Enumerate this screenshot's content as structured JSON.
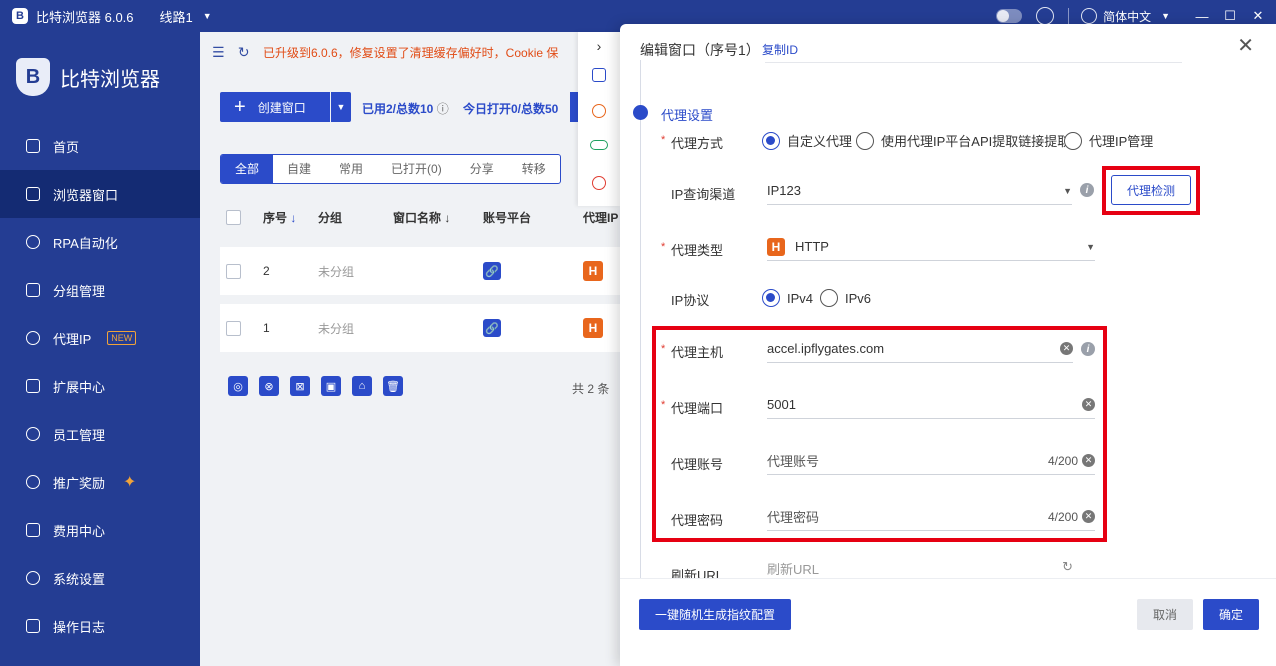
{
  "titlebar": {
    "app_title": "比特浏览器 6.0.6",
    "line": "线路1",
    "language": "简体中文"
  },
  "brand": {
    "name": "比特浏览器"
  },
  "sidebar": {
    "items": [
      {
        "label": "首页",
        "icon": "home-icon"
      },
      {
        "label": "浏览器窗口",
        "icon": "grid-icon",
        "active": true
      },
      {
        "label": "RPA自动化",
        "icon": "rpa-icon"
      },
      {
        "label": "分组管理",
        "icon": "layers-icon"
      },
      {
        "label": "代理IP",
        "icon": "location-icon",
        "badge": "NEW"
      },
      {
        "label": "扩展中心",
        "icon": "cube-icon"
      },
      {
        "label": "员工管理",
        "icon": "users-icon"
      },
      {
        "label": "推广奖励",
        "icon": "reward-icon"
      },
      {
        "label": "费用中心",
        "icon": "shield-icon"
      },
      {
        "label": "系统设置",
        "icon": "gear-icon"
      },
      {
        "label": "操作日志",
        "icon": "log-icon"
      }
    ]
  },
  "main": {
    "notice": "已升级到6.0.6，修复设置了清理缓存偏好时，Cookie 保",
    "create_label": "创建窗口",
    "used": "已用2/总数10",
    "today_open": "今日打开0/总数50",
    "tabs": [
      "全部",
      "自建",
      "常用",
      "已打开(0)",
      "分享",
      "转移"
    ],
    "columns": [
      "序号",
      "分组",
      "窗口名称",
      "账号平台",
      "代理IP"
    ],
    "rows": [
      {
        "index": "2",
        "group": "未分组"
      },
      {
        "index": "1",
        "group": "未分组"
      }
    ],
    "total": "共 2 条"
  },
  "drawer": {
    "title": "编辑窗口（序号1）",
    "copy_id": "复制ID",
    "section": "代理设置",
    "proxy_method_label": "代理方式",
    "proxy_methods": [
      "自定义代理",
      "使用代理IP平台API提取链接提取",
      "代理IP管理"
    ],
    "ip_channel_label": "IP查询渠道",
    "ip_channel_value": "IP123",
    "check_button": "代理检测",
    "proxy_type_label": "代理类型",
    "proxy_type_value": "HTTP",
    "ip_protocol_label": "IP协议",
    "ip_protocols": [
      "IPv4",
      "IPv6"
    ],
    "host_label": "代理主机",
    "host_value": "accel.ipflygates.com",
    "port_label": "代理端口",
    "port_value": "5001",
    "account_label": "代理账号",
    "account_placeholder": "代理账号",
    "account_counter": "4/200",
    "password_label": "代理密码",
    "password_placeholder": "代理密码",
    "password_counter": "4/200",
    "refresh_label": "刷新URL",
    "refresh_placeholder": "刷新URL",
    "generate_button": "一键随机生成指纹配置",
    "cancel_button": "取消",
    "ok_button": "确定"
  },
  "colors": {
    "primary": "#2b4bc9",
    "sidebar": "#243d93",
    "highlight": "#e60012",
    "notice": "#e14c16"
  }
}
